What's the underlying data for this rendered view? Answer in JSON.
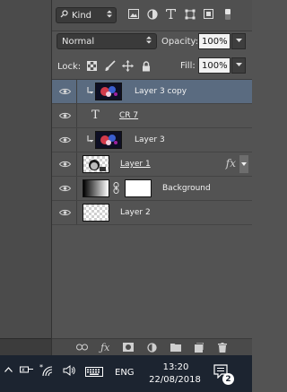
{
  "filter": {
    "kind_label": "Kind",
    "icons": [
      "image-filter-icon",
      "adjustment-filter-icon",
      "type-filter-icon",
      "shape-filter-icon",
      "smart-object-filter-icon",
      "filter-toggle-icon"
    ]
  },
  "blend": {
    "mode": "Normal",
    "opacity_label": "Opacity:",
    "opacity_value": "100%"
  },
  "lock": {
    "label": "Lock:",
    "fill_label": "Fill:",
    "fill_value": "100%"
  },
  "layers": [
    {
      "name": "Layer 3 copy",
      "selected": true,
      "clipped": true,
      "thumb": "fireworks"
    },
    {
      "name": "CR 7",
      "selected": false,
      "clipped": false,
      "thumb": "text"
    },
    {
      "name": "Layer 3",
      "selected": false,
      "clipped": true,
      "thumb": "fireworks"
    },
    {
      "name": "Layer 1",
      "selected": false,
      "clipped": false,
      "thumb": "portrait",
      "fx": "fx"
    },
    {
      "name": "Background",
      "selected": false,
      "clipped": false,
      "thumb": "gradient-mask"
    },
    {
      "name": "Layer 2",
      "selected": false,
      "clipped": false,
      "thumb": "transparent"
    }
  ],
  "colors": {
    "panel_bg": "#535353",
    "selected_row": "#5a6b80",
    "taskbar_bg": "#1c2430"
  },
  "taskbar": {
    "keyboard_lang": "ENG",
    "time": "13:20",
    "date": "22/08/2018",
    "notification_count": "2"
  }
}
